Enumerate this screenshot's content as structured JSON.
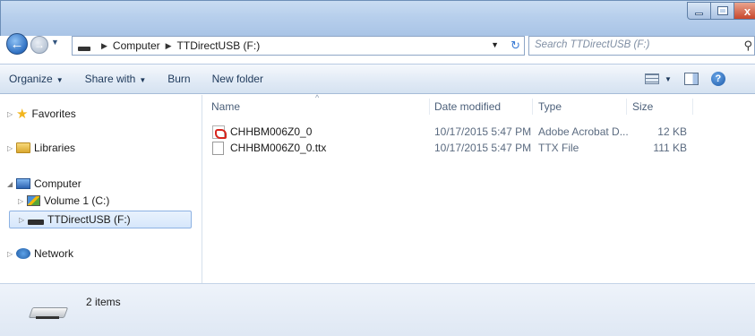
{
  "window": {
    "close_glyph": "x"
  },
  "address": {
    "crumbs": [
      "Computer",
      "TTDirectUSB (F:)"
    ],
    "refresh_glyph": "↻"
  },
  "search": {
    "placeholder": "Search TTDirectUSB (F:)"
  },
  "toolbar": {
    "organize": "Organize",
    "share_with": "Share with",
    "burn": "Burn",
    "new_folder": "New folder",
    "help_glyph": "?"
  },
  "sidebar": {
    "favorites": "Favorites",
    "libraries": "Libraries",
    "computer": "Computer",
    "volume1": "Volume 1 (C:)",
    "ttdirect": "TTDirectUSB (F:)",
    "network": "Network"
  },
  "columns": {
    "name": "Name",
    "date": "Date modified",
    "type": "Type",
    "size": "Size"
  },
  "files": [
    {
      "name": "CHHBM006Z0_0",
      "date": "10/17/2015 5:47 PM",
      "type": "Adobe Acrobat D...",
      "size": "12 KB",
      "icon": "pdf-icon"
    },
    {
      "name": "CHHBM006Z0_0.ttx",
      "date": "10/17/2015 5:47 PM",
      "type": "TTX File",
      "size": "111 KB",
      "icon": "document-icon"
    }
  ],
  "details": {
    "count": "2 items"
  },
  "colors": {
    "toolbar": "#dde8f5",
    "selection": "#d6e7fb",
    "text_blue": "#1e395b"
  }
}
